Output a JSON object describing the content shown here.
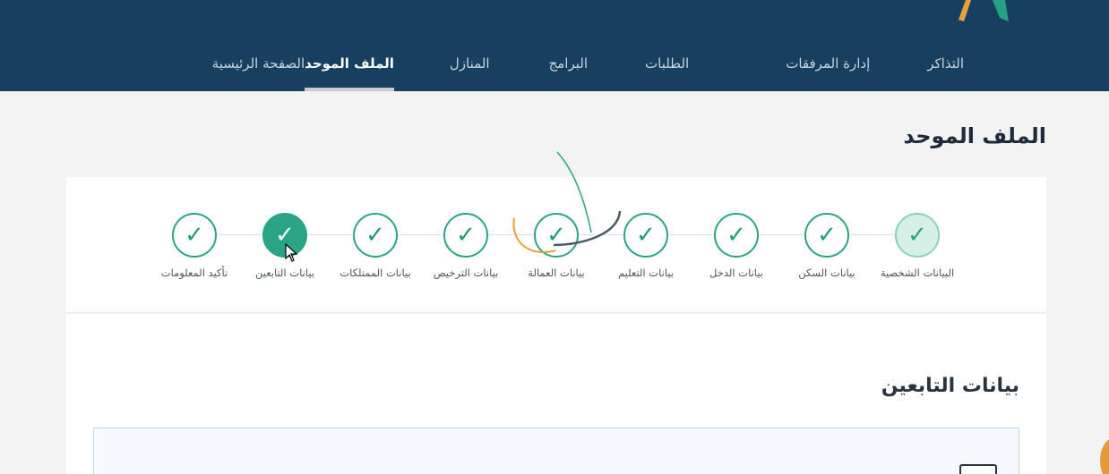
{
  "nav": {
    "items": [
      {
        "label": "الصفحة الرئيسية",
        "active": false
      },
      {
        "label": "الملف الموحد",
        "active": true
      },
      {
        "label": "المنازل",
        "active": false
      },
      {
        "label": "البرامج",
        "active": false
      },
      {
        "label": "الطلبات",
        "active": false
      },
      {
        "label": "إدارة المرفقات",
        "active": false
      },
      {
        "label": "التذاكر",
        "active": false
      }
    ]
  },
  "page": {
    "title": "الملف الموحد"
  },
  "steps": [
    {
      "label": "البيانات الشخصية",
      "state": "completed-first"
    },
    {
      "label": "بيانات السكن",
      "state": "completed"
    },
    {
      "label": "بيانات الدخل",
      "state": "completed"
    },
    {
      "label": "بيانات التعليم",
      "state": "completed"
    },
    {
      "label": "بيانات العمالة",
      "state": "completed"
    },
    {
      "label": "بيانات الترخيص",
      "state": "completed"
    },
    {
      "label": "بيانات الممتلكات",
      "state": "completed"
    },
    {
      "label": "بيانات التابعين",
      "state": "current"
    },
    {
      "label": "تأكيد المعلومات",
      "state": "completed"
    }
  ],
  "step_icon": "check-icon",
  "section": {
    "title": "بيانات التابعين"
  },
  "colors": {
    "header_bg": "#173f5f",
    "accent_green": "#2aa487",
    "page_bg": "#f3f3f4"
  }
}
